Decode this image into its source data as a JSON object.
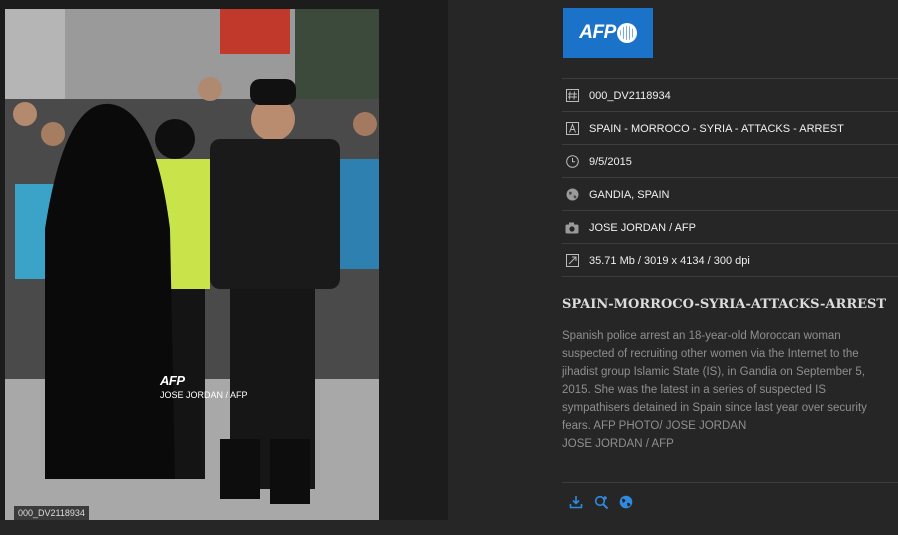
{
  "photo": {
    "watermark_logo": "AFP",
    "watermark_credit": "JOSE JORDAN / AFP",
    "id_label": "000_DV2118934"
  },
  "brand": {
    "logo_text": "AFP",
    "color": "#1a73c9"
  },
  "meta": {
    "id": "000_DV2118934",
    "slug": "SPAIN - MORROCO - SYRIA - ATTACKS - ARREST",
    "date": "9/5/2015",
    "location": "GANDIA, SPAIN",
    "credit": "JOSE JORDAN / AFP",
    "file_info": "35.71 Mb / 3019 x 4134 / 300 dpi"
  },
  "headline": "SPAIN-MORROCO-SYRIA-ATTACKS-ARREST",
  "caption": {
    "text": "Spanish police arrest an 18-year-old Moroccan woman suspected of recruiting other women via the Internet to the jihadist group Islamic State (IS), in Gandia on September 5, 2015. She was the latest in a series of suspected IS sympathisers detained in Spain since last year over security fears. AFP PHOTO/ JOSE JORDAN",
    "credit": "JOSE JORDAN / AFP"
  },
  "icons": {
    "id": "hash-icon",
    "slug": "text-icon",
    "date": "clock-icon",
    "location": "globe-icon",
    "credit": "camera-icon",
    "file_info": "resize-icon",
    "actions": [
      "download-icon",
      "zoom-in-icon",
      "globe-icon"
    ],
    "accent": "#2f8be0"
  }
}
